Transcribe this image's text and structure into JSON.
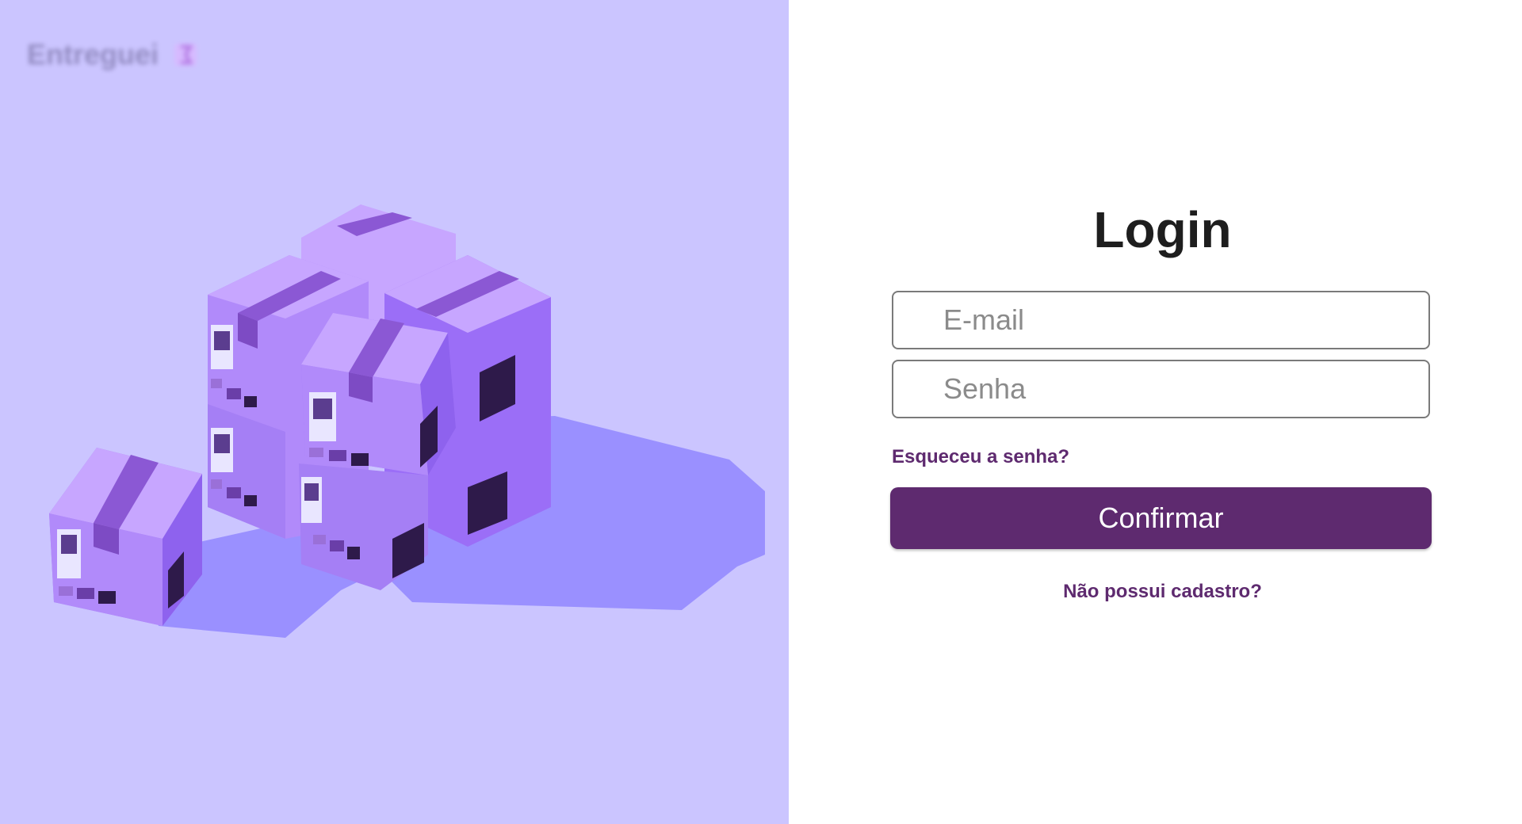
{
  "brand": {
    "name": "Entreguei",
    "logo_icon": "box-logo-icon"
  },
  "illustration": {
    "icon": "stacked-boxes-illustration"
  },
  "login": {
    "title": "Login",
    "email_placeholder": "E-mail",
    "password_placeholder": "Senha",
    "forgot_label": "Esqueceu a senha?",
    "confirm_label": "Confirmar",
    "register_label": "Não possui cadastro?"
  },
  "colors": {
    "left_background": "#cbc5ff",
    "primary": "#5e2a6f",
    "box_light": "#b487ff",
    "shadow": "#9a90ff"
  }
}
